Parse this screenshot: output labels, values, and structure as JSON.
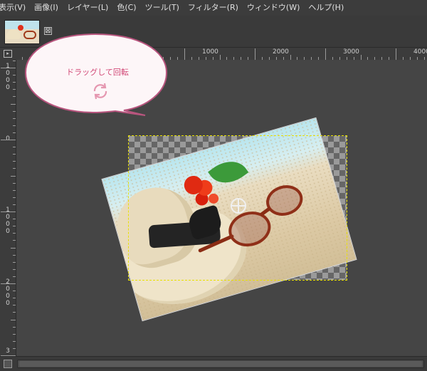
{
  "menu": {
    "items": [
      {
        "label": "表示(V)"
      },
      {
        "label": "画像(I)"
      },
      {
        "label": "レイヤー(L)"
      },
      {
        "label": "色(C)"
      },
      {
        "label": "ツール(T)"
      },
      {
        "label": "フィルター(R)"
      },
      {
        "label": "ウィンドウ(W)"
      },
      {
        "label": "ヘルプ(H)"
      }
    ]
  },
  "tab": {
    "close_glyph": "⊠"
  },
  "ruler": {
    "corner_glyph": "▸",
    "top_labels": [
      "1000",
      "2000",
      "3000",
      "4000"
    ],
    "left_labels": [
      "1000",
      "0",
      "1000",
      "2000",
      "3"
    ]
  },
  "balloon": {
    "text": "ドラッグして回転",
    "icon": "rotate-arrows-icon"
  },
  "colors": {
    "bg": "#454545",
    "menubar": "#3c3c3c",
    "selection_dash": "#e8e000",
    "balloon_text": "#d24a78",
    "balloon_border": "#b8557e"
  }
}
